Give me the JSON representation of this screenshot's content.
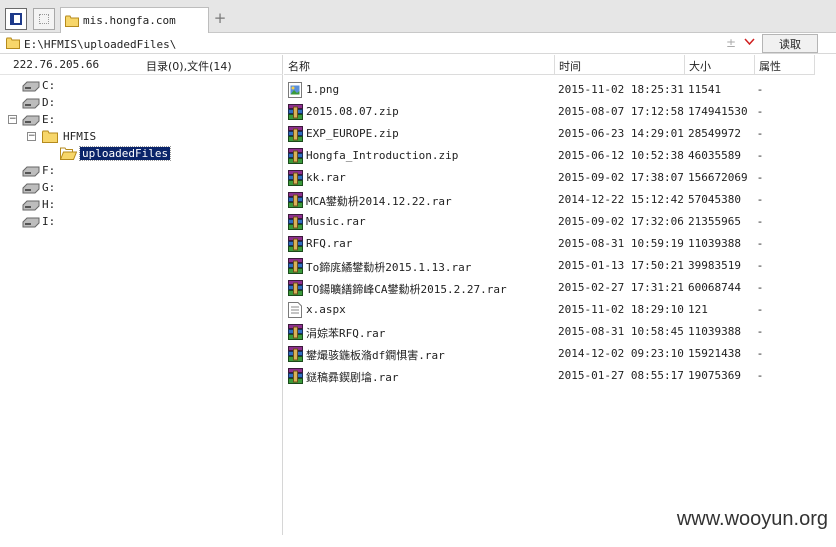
{
  "tab": {
    "title": "mis.hongfa.com",
    "new_tab": "+"
  },
  "address": {
    "path": "E:\\HFMIS\\uploadedFiles\\",
    "star": "±",
    "read_label": "读取"
  },
  "left": {
    "ip": "222.76.205.66",
    "counts": "目录(0),文件(14)",
    "drives": [
      {
        "label": "C:"
      },
      {
        "label": "D:"
      },
      {
        "label": "E:"
      },
      {
        "label": "F:"
      },
      {
        "label": "G:"
      },
      {
        "label": "H:"
      },
      {
        "label": "I:"
      }
    ],
    "folders": [
      {
        "label": "HFMIS"
      },
      {
        "label": "uploadedFiles"
      }
    ]
  },
  "columns": {
    "name": "名称",
    "time": "时间",
    "size": "大小",
    "attr": "属性"
  },
  "files": [
    {
      "name": "1.png",
      "time": "2015-11-02 18:25:31",
      "size": "11541",
      "attr": "-",
      "icon": "png-icon"
    },
    {
      "name": "2015.08.07.zip",
      "time": "2015-08-07 17:12:58",
      "size": "174941530",
      "attr": "-",
      "icon": "archive-icon"
    },
    {
      "name": "EXP_EUROPE.zip",
      "time": "2015-06-23 14:29:01",
      "size": "28549972",
      "attr": "-",
      "icon": "archive-icon"
    },
    {
      "name": "Hongfa_Introduction.zip",
      "time": "2015-06-12 10:52:38",
      "size": "46035589",
      "attr": "-",
      "icon": "archive-icon"
    },
    {
      "name": "kk.rar",
      "time": "2015-09-02 17:38:07",
      "size": "156672069",
      "attr": "-",
      "icon": "archive-icon"
    },
    {
      "name": "MCA鐢勬枡2014.12.22.rar",
      "time": "2014-12-22 15:12:42",
      "size": "57045380",
      "attr": "-",
      "icon": "archive-icon"
    },
    {
      "name": "Music.rar",
      "time": "2015-09-02 17:32:06",
      "size": "21355965",
      "attr": "-",
      "icon": "archive-icon"
    },
    {
      "name": "RFQ.rar",
      "time": "2015-08-31 10:59:19",
      "size": "11039388",
      "attr": "-",
      "icon": "archive-icon"
    },
    {
      "name": "To鍗庣繘鐢勬枡2015.1.13.rar",
      "time": "2015-01-13 17:50:21",
      "size": "39983519",
      "attr": "-",
      "icon": "archive-icon"
    },
    {
      "name": "TO鍚曠繕鍗峰CA鐢勬枡2015.2.27.rar",
      "time": "2015-02-27 17:31:21",
      "size": "60068744",
      "attr": "-",
      "icon": "archive-icon"
    },
    {
      "name": "x.aspx",
      "time": "2015-11-02 18:29:10",
      "size": "121",
      "attr": "-",
      "icon": "text-file-icon"
    },
    {
      "name": "涓婃苯RFQ.rar",
      "time": "2015-08-31 10:58:45",
      "size": "11039388",
      "attr": "-",
      "icon": "archive-icon"
    },
    {
      "name": "鐢熶骇鍦板潃df鐧惧害.rar",
      "time": "2014-12-02 09:23:10",
      "size": "15921438",
      "attr": "-",
      "icon": "archive-icon"
    },
    {
      "name": "鎹稿彞鍥剧墖.rar",
      "time": "2015-01-27 08:55:17",
      "size": "19075369",
      "attr": "-",
      "icon": "archive-icon"
    }
  ],
  "watermark": "www.wooyun.org"
}
